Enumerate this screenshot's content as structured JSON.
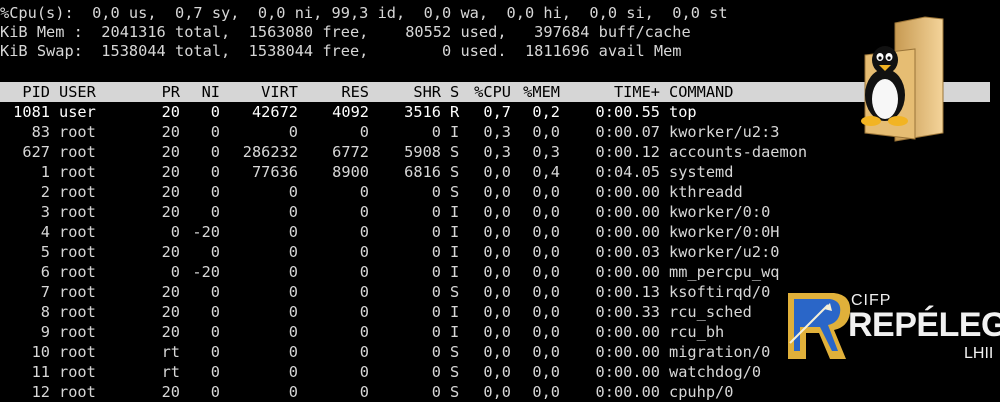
{
  "summary": {
    "cpu": "%Cpu(s):  0,0 us,  0,7 sy,  0,0 ni, 99,3 id,  0,0 wa,  0,0 hi,  0,0 si,  0,0 st",
    "mem": "KiB Mem :  2041316 total,  1563080 free,    80552 used,   397684 buff/cache",
    "swap": "KiB Swap:  1538044 total,  1538044 free,        0 used.  1811696 avail Mem"
  },
  "table": {
    "headers": [
      "PID",
      "USER",
      "PR",
      "NI",
      "VIRT",
      "RES",
      "SHR",
      "S",
      "%CPU",
      "%MEM",
      "TIME+",
      "COMMAND"
    ],
    "rows": [
      [
        "1081",
        "user",
        "20",
        "0",
        "42672",
        "4092",
        "3516",
        "R",
        "0,7",
        "0,2",
        "0:00.55",
        "top"
      ],
      [
        "83",
        "root",
        "20",
        "0",
        "0",
        "0",
        "0",
        "I",
        "0,3",
        "0,0",
        "0:00.07",
        "kworker/u2:3"
      ],
      [
        "627",
        "root",
        "20",
        "0",
        "286232",
        "6772",
        "5908",
        "S",
        "0,3",
        "0,3",
        "0:00.12",
        "accounts-daemon"
      ],
      [
        "1",
        "root",
        "20",
        "0",
        "77636",
        "8900",
        "6816",
        "S",
        "0,0",
        "0,4",
        "0:04.05",
        "systemd"
      ],
      [
        "2",
        "root",
        "20",
        "0",
        "0",
        "0",
        "0",
        "S",
        "0,0",
        "0,0",
        "0:00.00",
        "kthreadd"
      ],
      [
        "3",
        "root",
        "20",
        "0",
        "0",
        "0",
        "0",
        "I",
        "0,0",
        "0,0",
        "0:00.00",
        "kworker/0:0"
      ],
      [
        "4",
        "root",
        "0",
        "-20",
        "0",
        "0",
        "0",
        "I",
        "0,0",
        "0,0",
        "0:00.00",
        "kworker/0:0H"
      ],
      [
        "5",
        "root",
        "20",
        "0",
        "0",
        "0",
        "0",
        "I",
        "0,0",
        "0,0",
        "0:00.03",
        "kworker/u2:0"
      ],
      [
        "6",
        "root",
        "0",
        "-20",
        "0",
        "0",
        "0",
        "I",
        "0,0",
        "0,0",
        "0:00.00",
        "mm_percpu_wq"
      ],
      [
        "7",
        "root",
        "20",
        "0",
        "0",
        "0",
        "0",
        "S",
        "0,0",
        "0,0",
        "0:00.13",
        "ksoftirqd/0"
      ],
      [
        "8",
        "root",
        "20",
        "0",
        "0",
        "0",
        "0",
        "I",
        "0,0",
        "0,0",
        "0:00.33",
        "rcu_sched"
      ],
      [
        "9",
        "root",
        "20",
        "0",
        "0",
        "0",
        "0",
        "I",
        "0,0",
        "0,0",
        "0:00.00",
        "rcu_bh"
      ],
      [
        "10",
        "root",
        "rt",
        "0",
        "0",
        "0",
        "0",
        "S",
        "0,0",
        "0,0",
        "0:00.00",
        "migration/0"
      ],
      [
        "11",
        "root",
        "rt",
        "0",
        "0",
        "0",
        "0",
        "S",
        "0,0",
        "0,0",
        "0:00.00",
        "watchdog/0"
      ],
      [
        "12",
        "root",
        "20",
        "0",
        "0",
        "0",
        "0",
        "S",
        "0,0",
        "0,0",
        "0:00.00",
        "cpuhp/0"
      ]
    ]
  },
  "logo": {
    "line1": "CIFP",
    "line2": "REPÉLEGA",
    "line3": "LHII"
  },
  "icons": {
    "folder": "linux-folder-icon",
    "logo_mark": "repelega-r-logo"
  },
  "colors": {
    "background": "#000000",
    "text": "#d7d7d7",
    "header_bg": "#d6d6d6",
    "folder": "#e9c27a",
    "logo_blue": "#2a66c8",
    "logo_gold": "#e0b03a"
  }
}
